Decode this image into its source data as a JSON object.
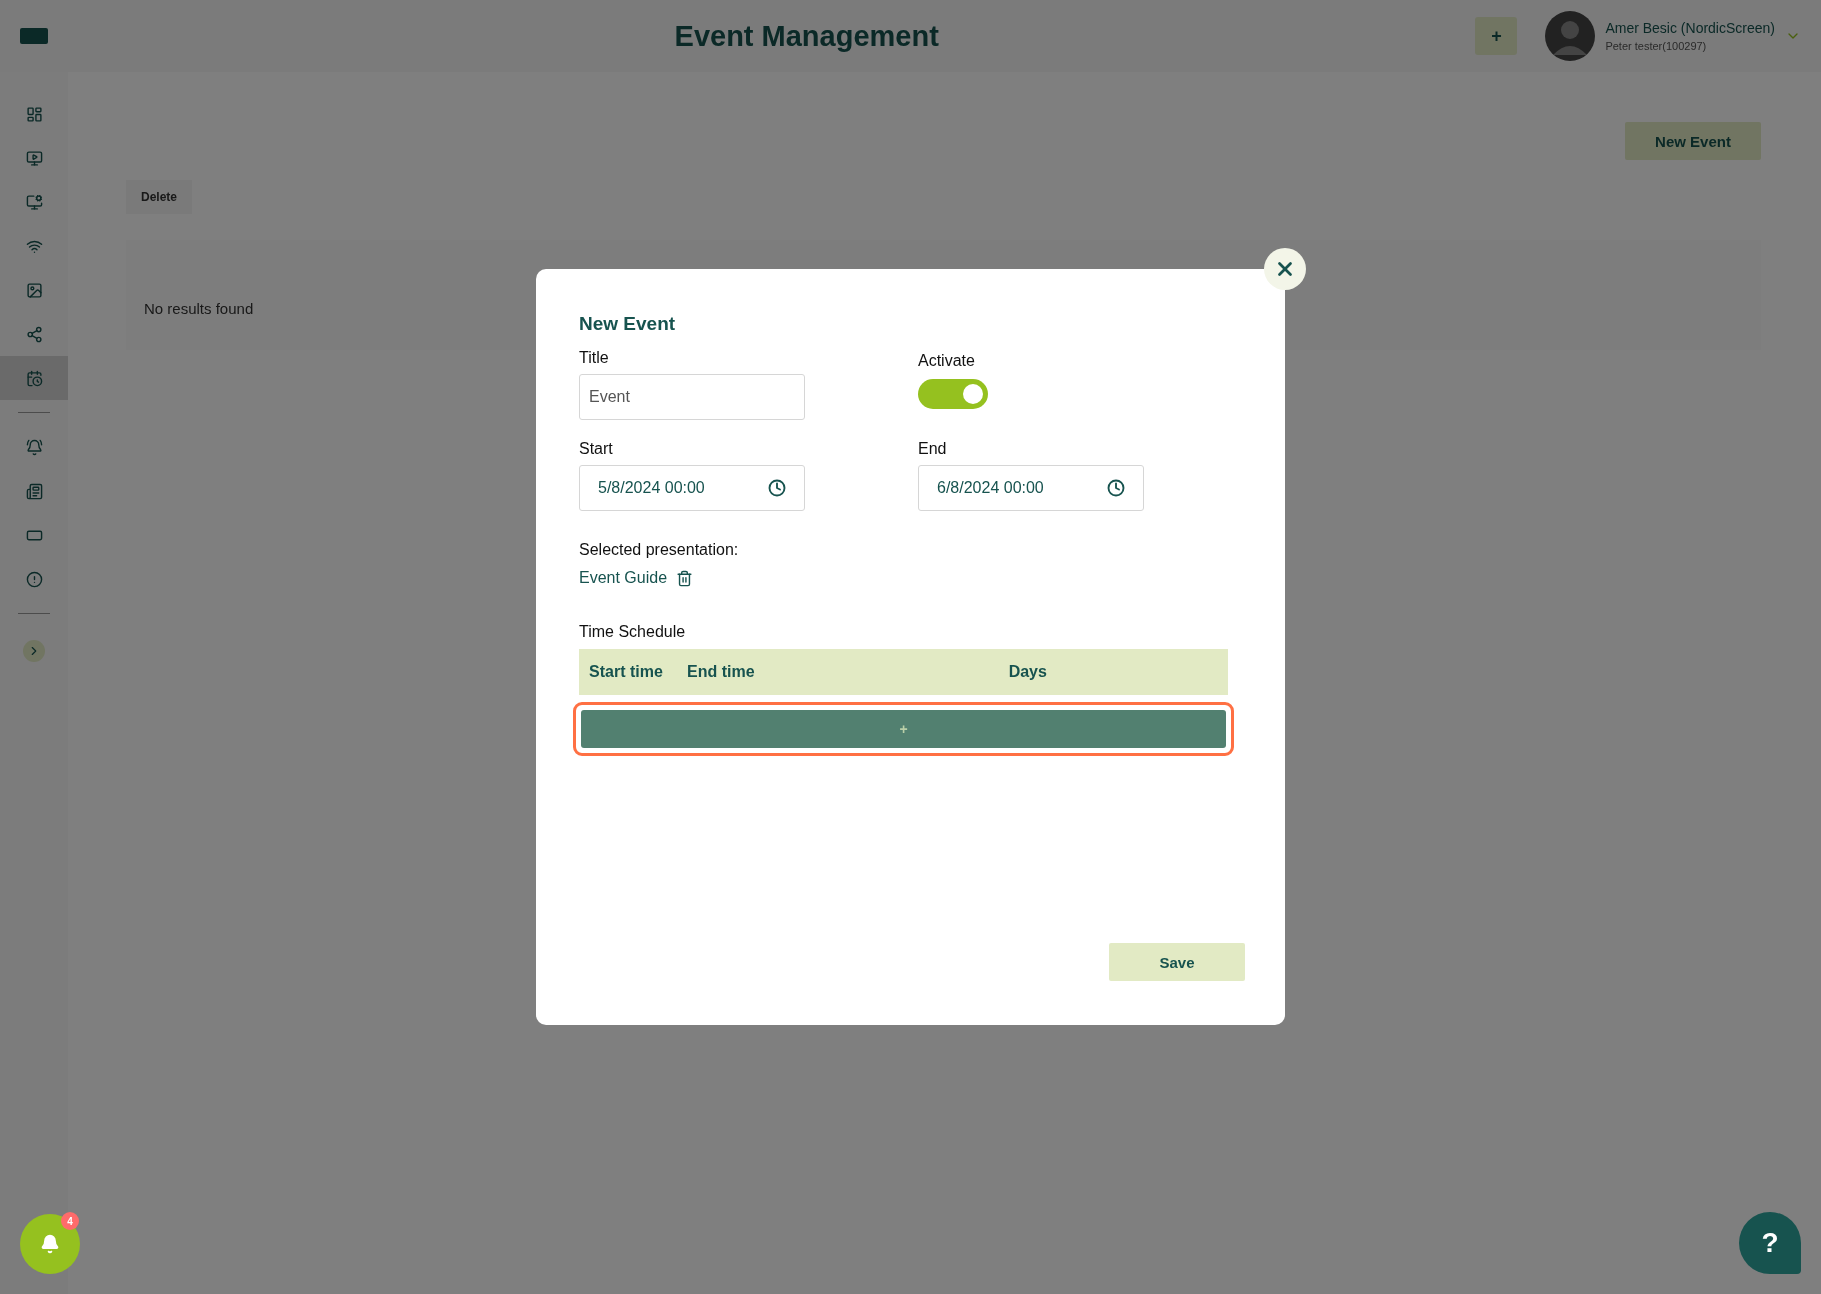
{
  "header": {
    "title": "Event Management",
    "add_button": "+",
    "user": {
      "name": "Amer Besic (NordicScreen)",
      "role": "Peter tester(100297)"
    }
  },
  "sidebar": {
    "groups": [
      [
        {
          "selected": false
        },
        {
          "selected": false
        },
        {
          "selected": false
        },
        {
          "selected": false
        },
        {
          "selected": false
        },
        {
          "selected": false
        },
        {
          "selected": true
        }
      ],
      [
        {
          "selected": false
        },
        {
          "selected": false
        },
        {
          "selected": false
        },
        {
          "selected": false
        }
      ]
    ]
  },
  "page": {
    "new_event_button": "New Event",
    "delete_button": "Delete",
    "empty_message": "No results found"
  },
  "modal": {
    "title": "New Event",
    "fields": {
      "title": {
        "label": "Title",
        "value": "Event"
      },
      "activate": {
        "label": "Activate",
        "on": true
      },
      "start": {
        "label": "Start",
        "value": "5/8/2024 00:00"
      },
      "end": {
        "label": "End",
        "value": "6/8/2024 00:00"
      }
    },
    "presentation": {
      "label": "Selected presentation:",
      "value": "Event Guide"
    },
    "schedule": {
      "title": "Time Schedule",
      "columns": [
        "Start time",
        "End time",
        "Days"
      ],
      "add_button": "+",
      "add_highlighted": true
    },
    "save_button": "Save"
  },
  "notifications": {
    "count": "4"
  },
  "help_button": "?"
}
